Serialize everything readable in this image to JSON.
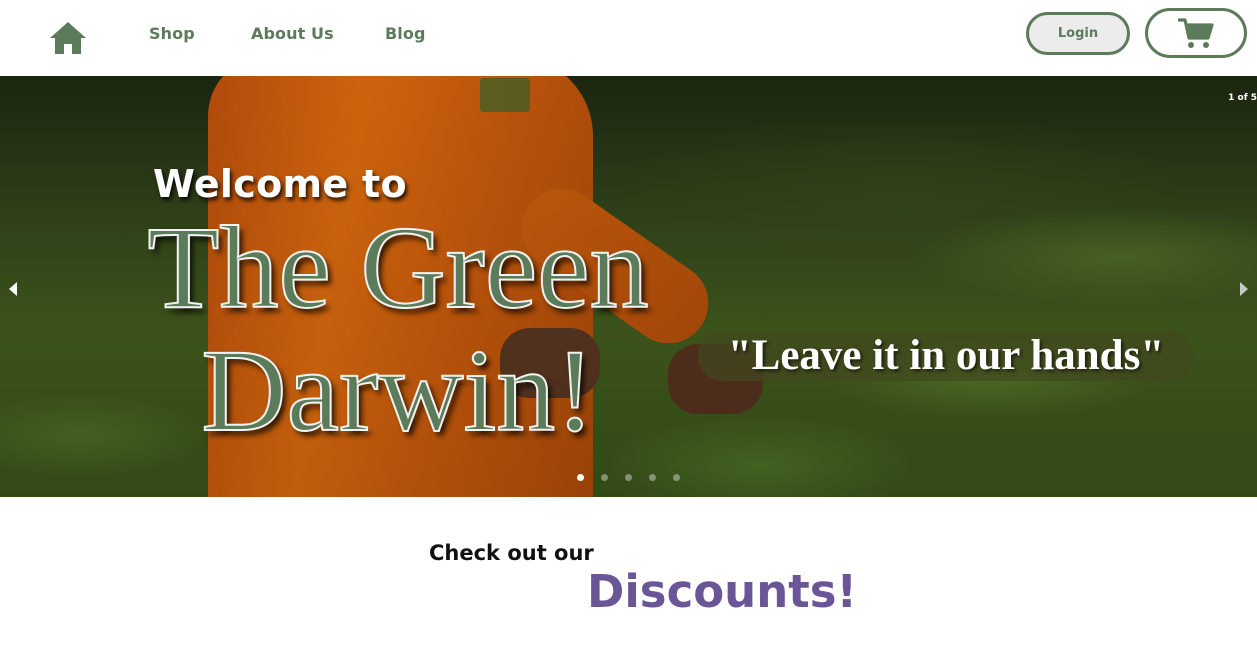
{
  "colors": {
    "brand_green": "#5b7b5a",
    "discount_purple": "#6a5597",
    "white": "#ffffff"
  },
  "nav": {
    "home_icon": "home-icon",
    "links": [
      {
        "label": "Shop"
      },
      {
        "label": "About Us"
      },
      {
        "label": "Blog"
      }
    ],
    "login_label": "Login",
    "cart_icon": "shopping-cart-icon"
  },
  "hero": {
    "slide_counter": "1 of 5",
    "welcome": "Welcome to",
    "title_line1": "The Green",
    "title_line2": "Darwin!",
    "tagline": "\"Leave it in our hands\"",
    "prev_icon": "caret-left-icon",
    "next_icon": "caret-right-icon",
    "slide_count": 5,
    "active_slide": 1
  },
  "discounts": {
    "intro": "Check out our",
    "heading": "Discounts!"
  }
}
